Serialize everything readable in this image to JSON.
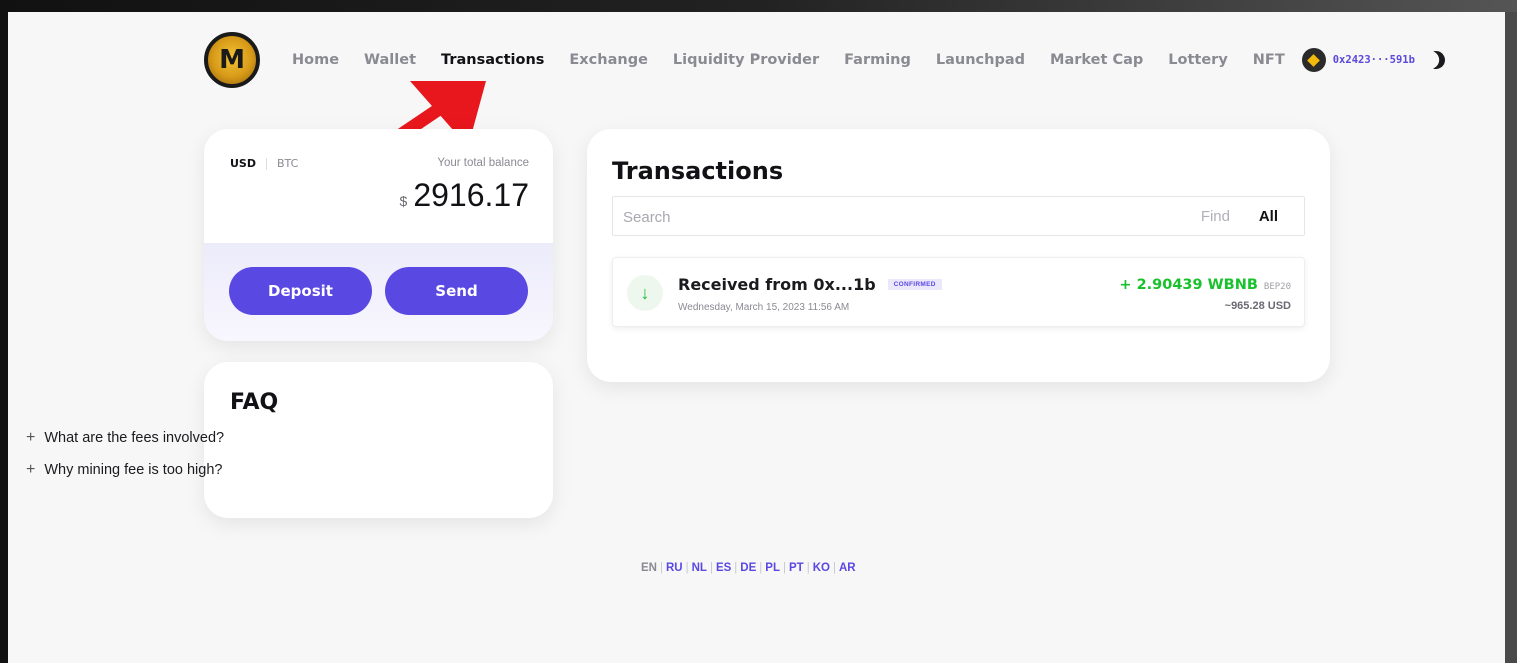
{
  "nav": {
    "logo_letter": "M",
    "links": [
      "Home",
      "Wallet",
      "Transactions",
      "Exchange",
      "Liquidity Provider",
      "Farming",
      "Launchpad",
      "Market Cap",
      "Lottery",
      "NFT"
    ],
    "active": "Transactions",
    "wallet_address": "0x2423···591b",
    "wallet_icon": "bnb-icon",
    "theme_icon": "moon-icon"
  },
  "annotation": {
    "icon": "red-arrow",
    "color": "#e8171d"
  },
  "balance": {
    "currencies": [
      "USD",
      "BTC"
    ],
    "active_currency": "USD",
    "label": "Your total balance",
    "currency_symbol": "$",
    "amount": "2916.17",
    "deposit_label": "Deposit",
    "send_label": "Send"
  },
  "faq": {
    "title": "FAQ",
    "items": [
      "What are the fees involved?",
      "Why mining fee is too high?"
    ]
  },
  "transactions": {
    "title": "Transactions",
    "search_placeholder": "Search",
    "find_label": "Find",
    "all_label": "All",
    "rows": [
      {
        "direction_icon": "arrow-down-icon",
        "title": "Received from 0x...1b",
        "status": "CONFIRMED",
        "date": "Wednesday, March 15, 2023 11:56 AM",
        "amount": "+ 2.90439 WBNB",
        "network": "BEP20",
        "usd": "~965.28 USD"
      }
    ]
  },
  "languages": [
    "EN",
    "RU",
    "NL",
    "ES",
    "DE",
    "PL",
    "PT",
    "KO",
    "AR"
  ],
  "current_language": "EN",
  "colors": {
    "accent": "#5a48e3",
    "positive": "#19c12c",
    "arrow": "#e8171d"
  }
}
